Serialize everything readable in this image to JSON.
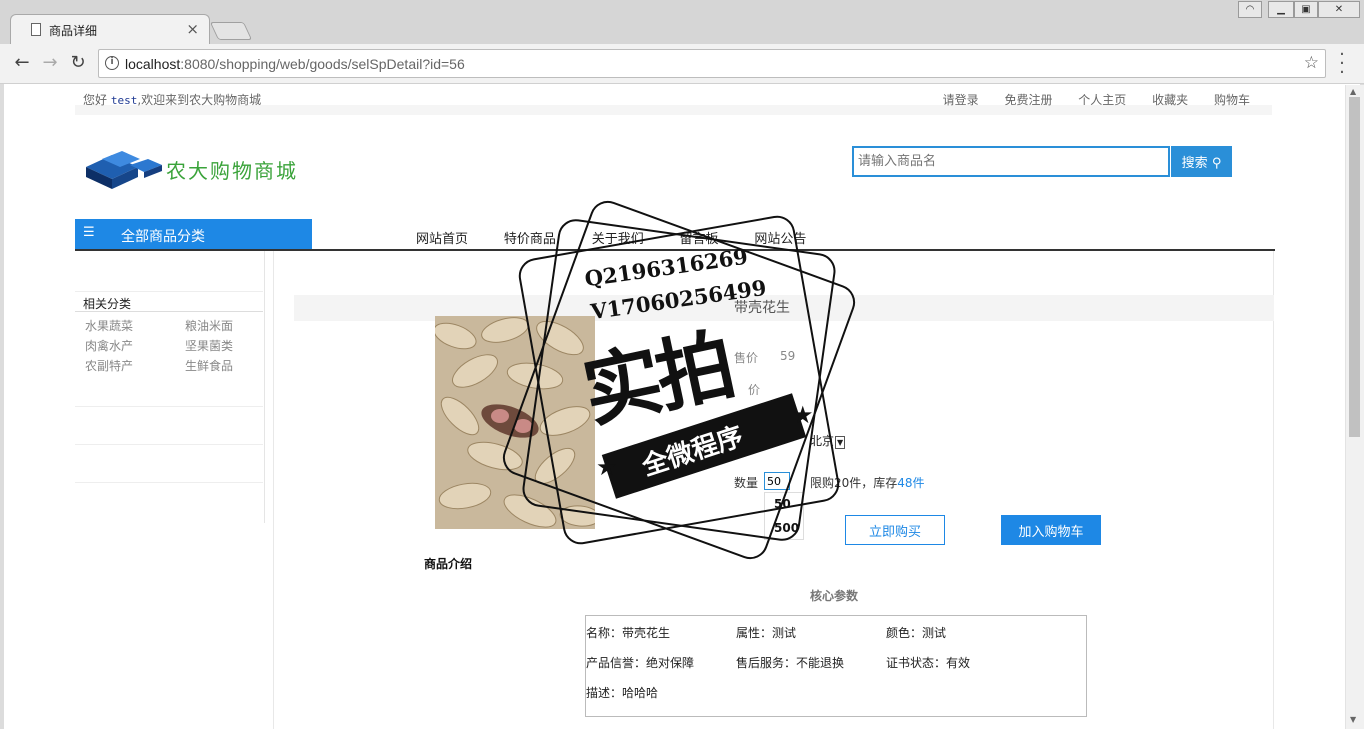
{
  "browser": {
    "tab_title": "商品详细",
    "url_host": "localhost",
    "url_path": ":8080/shopping/web/goods/selSpDetail?id=56"
  },
  "topbar": {
    "greeting_prefix": "您好",
    "username": "test",
    "greeting_suffix": ",欢迎来到农大购物商城",
    "links": [
      "请登录",
      "免费注册",
      "个人主页",
      "收藏夹",
      "购物车"
    ]
  },
  "logo": {
    "text": "农大购物商城"
  },
  "search": {
    "placeholder": "请输入商品名",
    "button_label": "搜索"
  },
  "category_bar": {
    "label": "全部商品分类"
  },
  "main_nav": [
    "网站首页",
    "特价商品",
    "关于我们",
    "留言板",
    "网站公告"
  ],
  "sidebar": {
    "title": "相关分类",
    "items": [
      "水果蔬菜",
      "粮油米面",
      "肉禽水产",
      "坚果菌类",
      "农副特产",
      "生鲜食品"
    ]
  },
  "product": {
    "name": "带壳花生",
    "price_label_1": "售价",
    "price_value_1": "59",
    "price_label_2": "价",
    "region": "北京",
    "qty_label": "数量",
    "qty_value": "50",
    "limit_text": "限购20件，库存",
    "stock": "48件",
    "qty_options": [
      "50",
      "500"
    ],
    "buy_now": "立即购买",
    "add_cart": "加入购物车"
  },
  "intro": {
    "title": "商品介绍",
    "params_title": "核心参数",
    "params": [
      "名称：带壳花生",
      "属性：测试",
      "颜色：测试",
      "产品信誉：绝对保障",
      "售后服务：不能退换",
      "证书状态：有效",
      "描述：哈哈哈"
    ]
  },
  "watermark": {
    "line1": "Q2196316269",
    "line2": "V17060256499",
    "big": "实拍",
    "ribbon": "全微程序"
  }
}
